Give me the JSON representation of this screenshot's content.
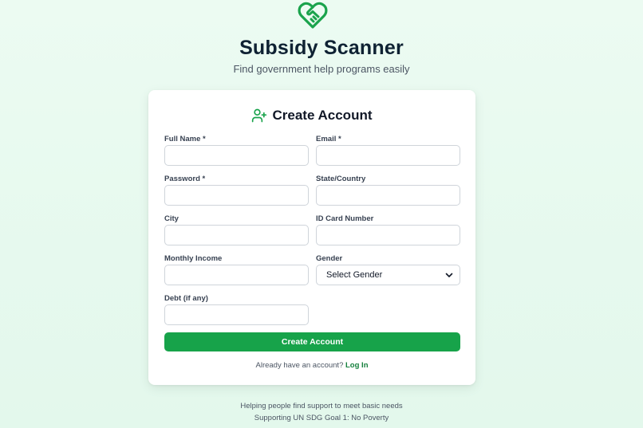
{
  "app": {
    "title": "Subsidy Scanner",
    "subtitle": "Find government help programs easily",
    "logo_icon": "heart-handshake-icon",
    "accent_color": "#17a34a"
  },
  "form": {
    "title": "Create Account",
    "title_icon": "user-plus-icon",
    "fields": {
      "full_name": {
        "label": "Full Name *",
        "value": ""
      },
      "email": {
        "label": "Email *",
        "value": ""
      },
      "password": {
        "label": "Password *",
        "value": ""
      },
      "state_country": {
        "label": "State/Country",
        "value": ""
      },
      "city": {
        "label": "City",
        "value": ""
      },
      "id_card": {
        "label": "ID Card Number",
        "value": ""
      },
      "monthly_income": {
        "label": "Monthly Income",
        "value": ""
      },
      "gender": {
        "label": "Gender",
        "selected": "Select Gender"
      },
      "debt": {
        "label": "Debt (if any)",
        "value": ""
      }
    },
    "submit_label": "Create Account",
    "login_prompt": "Already have an account?",
    "login_link": "Log In"
  },
  "footer": {
    "line1": "Helping people find support to meet basic needs",
    "line2": "Supporting UN SDG Goal 1: No Poverty"
  }
}
